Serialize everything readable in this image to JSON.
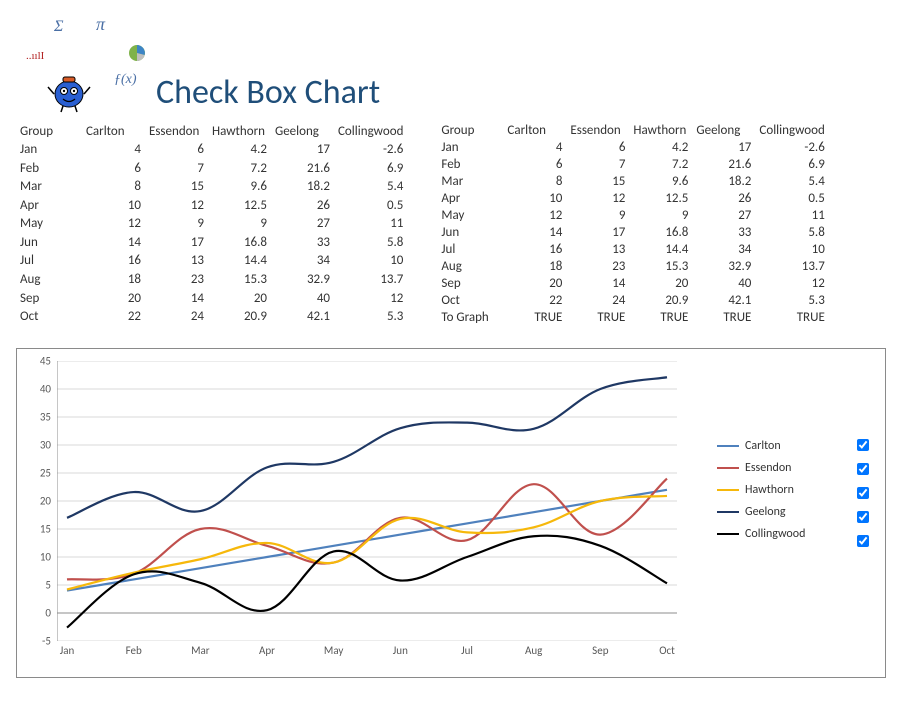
{
  "title": "Check Box Chart",
  "decor": {
    "sigma": "Σ",
    "pi": "π",
    "fx": "ƒ(x)",
    "bars": "..ıılI"
  },
  "columns": [
    "Group",
    "Carlton",
    "Essendon",
    "Hawthorn",
    "Geelong",
    "Collingwood"
  ],
  "months": [
    "Jan",
    "Feb",
    "Mar",
    "Apr",
    "May",
    "Jun",
    "Jul",
    "Aug",
    "Sep",
    "Oct"
  ],
  "data": {
    "Carlton": [
      4,
      6,
      8,
      10,
      12,
      14,
      16,
      18,
      20,
      22
    ],
    "Essendon": [
      6,
      7,
      15,
      12,
      9,
      17,
      13,
      23,
      14,
      24
    ],
    "Hawthorn": [
      4.2,
      7.2,
      9.6,
      12.5,
      9,
      16.8,
      14.4,
      15.3,
      20,
      20.9
    ],
    "Geelong": [
      17,
      21.6,
      18.2,
      26,
      27,
      33,
      34,
      32.9,
      40,
      42.1
    ],
    "Collingwood": [
      -2.6,
      6.9,
      5.4,
      0.5,
      11,
      5.8,
      10,
      13.7,
      12,
      5.3
    ]
  },
  "toGraphLabel": "To Graph",
  "toGraph": [
    "TRUE",
    "TRUE",
    "TRUE",
    "TRUE",
    "TRUE"
  ],
  "legend": [
    {
      "name": "Carlton",
      "color": "#4f81bd"
    },
    {
      "name": "Essendon",
      "color": "#c0504d"
    },
    {
      "name": "Hawthorn",
      "color": "#f6b80b"
    },
    {
      "name": "Geelong",
      "color": "#1f3864"
    },
    {
      "name": "Collingwood",
      "color": "#000000"
    }
  ],
  "yticks": [
    -5,
    0,
    5,
    10,
    15,
    20,
    25,
    30,
    35,
    40,
    45
  ],
  "chart_data": {
    "type": "line",
    "title": "",
    "xlabel": "",
    "ylabel": "",
    "ylim": [
      -5,
      45
    ],
    "categories": [
      "Jan",
      "Feb",
      "Mar",
      "Apr",
      "May",
      "Jun",
      "Jul",
      "Aug",
      "Sep",
      "Oct"
    ],
    "series": [
      {
        "name": "Carlton",
        "color": "#4f81bd",
        "values": [
          4,
          6,
          8,
          10,
          12,
          14,
          16,
          18,
          20,
          22
        ]
      },
      {
        "name": "Essendon",
        "color": "#c0504d",
        "values": [
          6,
          7,
          15,
          12,
          9,
          17,
          13,
          23,
          14,
          24
        ]
      },
      {
        "name": "Hawthorn",
        "color": "#f6b80b",
        "values": [
          4.2,
          7.2,
          9.6,
          12.5,
          9,
          16.8,
          14.4,
          15.3,
          20,
          20.9
        ]
      },
      {
        "name": "Geelong",
        "color": "#1f3864",
        "values": [
          17,
          21.6,
          18.2,
          26,
          27,
          33,
          34,
          32.9,
          40,
          42.1
        ]
      },
      {
        "name": "Collingwood",
        "color": "#000000",
        "values": [
          -2.6,
          6.9,
          5.4,
          0.5,
          11,
          5.8,
          10,
          13.7,
          12,
          5.3
        ]
      }
    ]
  }
}
